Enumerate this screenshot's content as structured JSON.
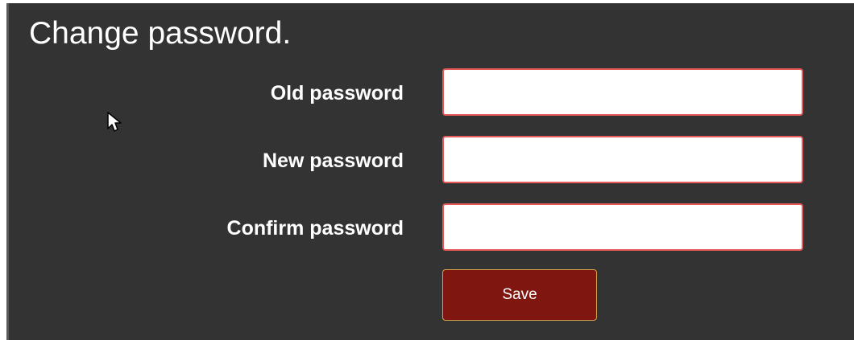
{
  "page": {
    "title": "Change password."
  },
  "form": {
    "fields": [
      {
        "label": "Old password",
        "value": "",
        "placeholder": ""
      },
      {
        "label": "New password",
        "value": "",
        "placeholder": ""
      },
      {
        "label": "Confirm password",
        "value": "",
        "placeholder": ""
      }
    ],
    "save_label": "Save"
  },
  "colors": {
    "panel_background": "#333333",
    "field_border": "#e85a5a",
    "button_background": "#7f1610",
    "button_border": "#d6a34a"
  },
  "icons": {
    "cursor": "mouse-pointer-icon"
  }
}
